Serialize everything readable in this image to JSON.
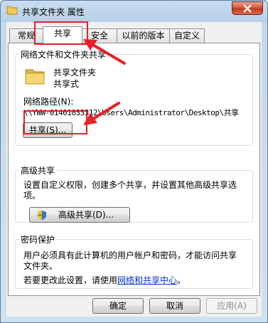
{
  "window": {
    "title": "共享文件夹 属性"
  },
  "tabs": [
    {
      "label": "常规"
    },
    {
      "label": "共享"
    },
    {
      "label": "安全"
    },
    {
      "label": "以前的版本"
    },
    {
      "label": "自定义"
    }
  ],
  "network_sharing": {
    "group_title": "网络文件和文件夹共享",
    "folder_name": "共享文件夹",
    "share_status": "共享式",
    "path_label": "网络路径(N):",
    "path_value": "\\\\YWW-01401033312\\Users\\Administrator\\Desktop\\共享",
    "share_button": "共享(S)..."
  },
  "advanced_sharing": {
    "group_title": "高级共享",
    "description": "设置自定义权限，创建多个共享，并设置其他高级共享选项。",
    "button": "高级共享(D)..."
  },
  "password_protection": {
    "group_title": "密码保护",
    "description_line1": "用户必须具有此计算机的用户帐户和密码，才能访问共享",
    "description_line2": "文件夹。",
    "change_prefix": "若要更改此设置，请使用",
    "link_text": "网络和共享中心",
    "change_suffix": "。"
  },
  "footer": {
    "ok": "确定",
    "cancel": "取消",
    "apply": "应用(A)"
  },
  "colors": {
    "annotation": "#e8202a",
    "link": "#0033cc"
  }
}
